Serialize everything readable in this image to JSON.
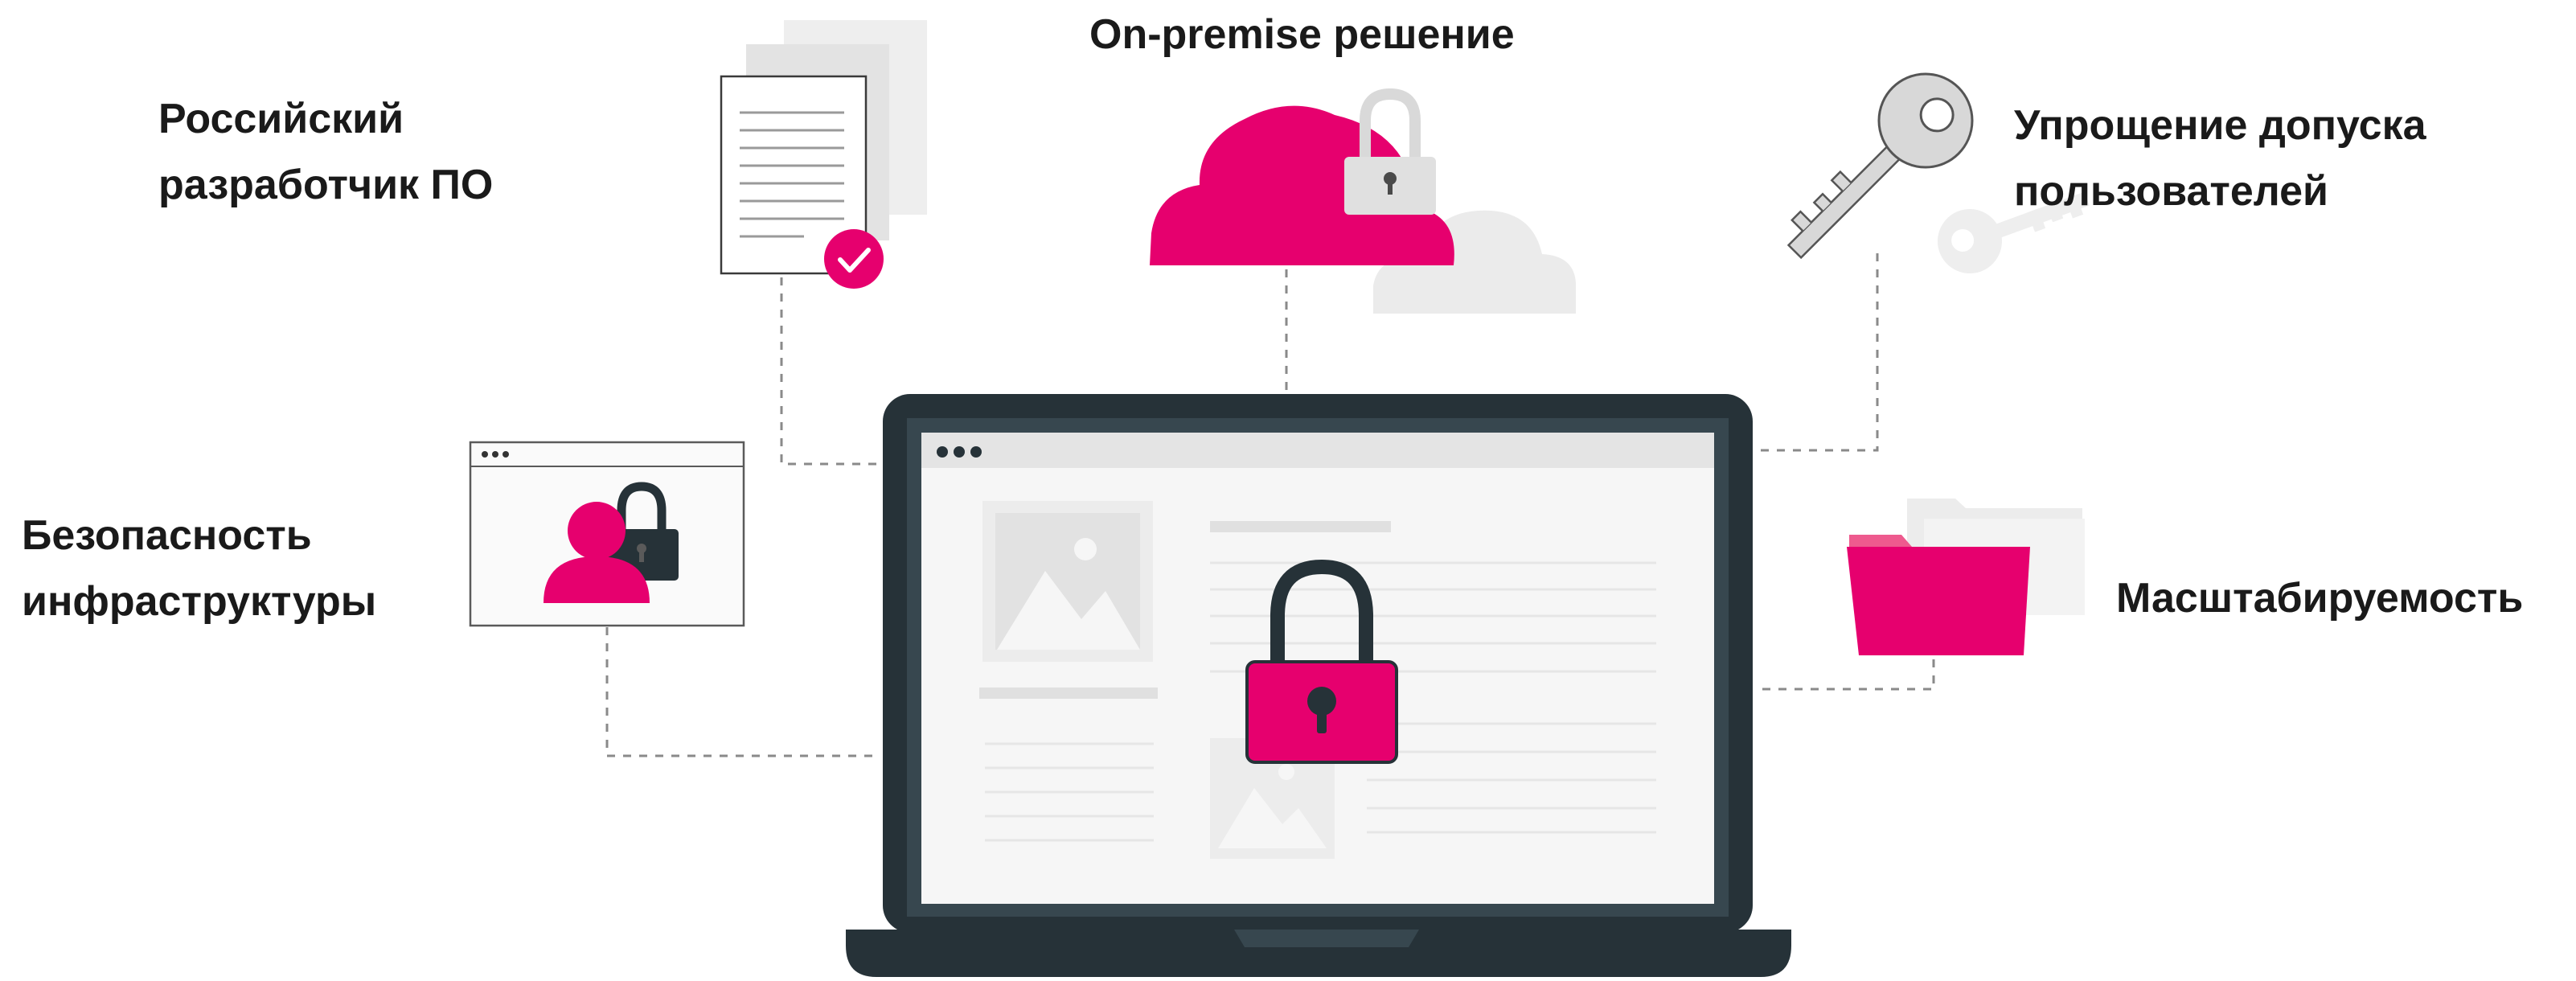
{
  "labels": {
    "on_premise": "On-premise решение",
    "russian_developer": [
      "Российский",
      "разработчик ПО"
    ],
    "access_simplification": [
      "Упрощение допуска",
      "пользователей"
    ],
    "infrastructure_security": [
      "Безопасность",
      "инфраструктуры"
    ],
    "scalability": "Масштабируемость"
  },
  "icons": {
    "document": "document-check-icon",
    "cloud": "cloud-lock-icon",
    "keys": "key-icon",
    "user_lock": "user-lock-window-icon",
    "folder": "folder-icon",
    "laptop": "laptop-lock-icon"
  },
  "colors": {
    "accent": "#E6006E",
    "dark": "#263238",
    "screen_bezel": "#37474F",
    "light_gray": "#E6E6E6",
    "mid_gray": "#C8C8C8",
    "text": "#1A1A1A"
  }
}
